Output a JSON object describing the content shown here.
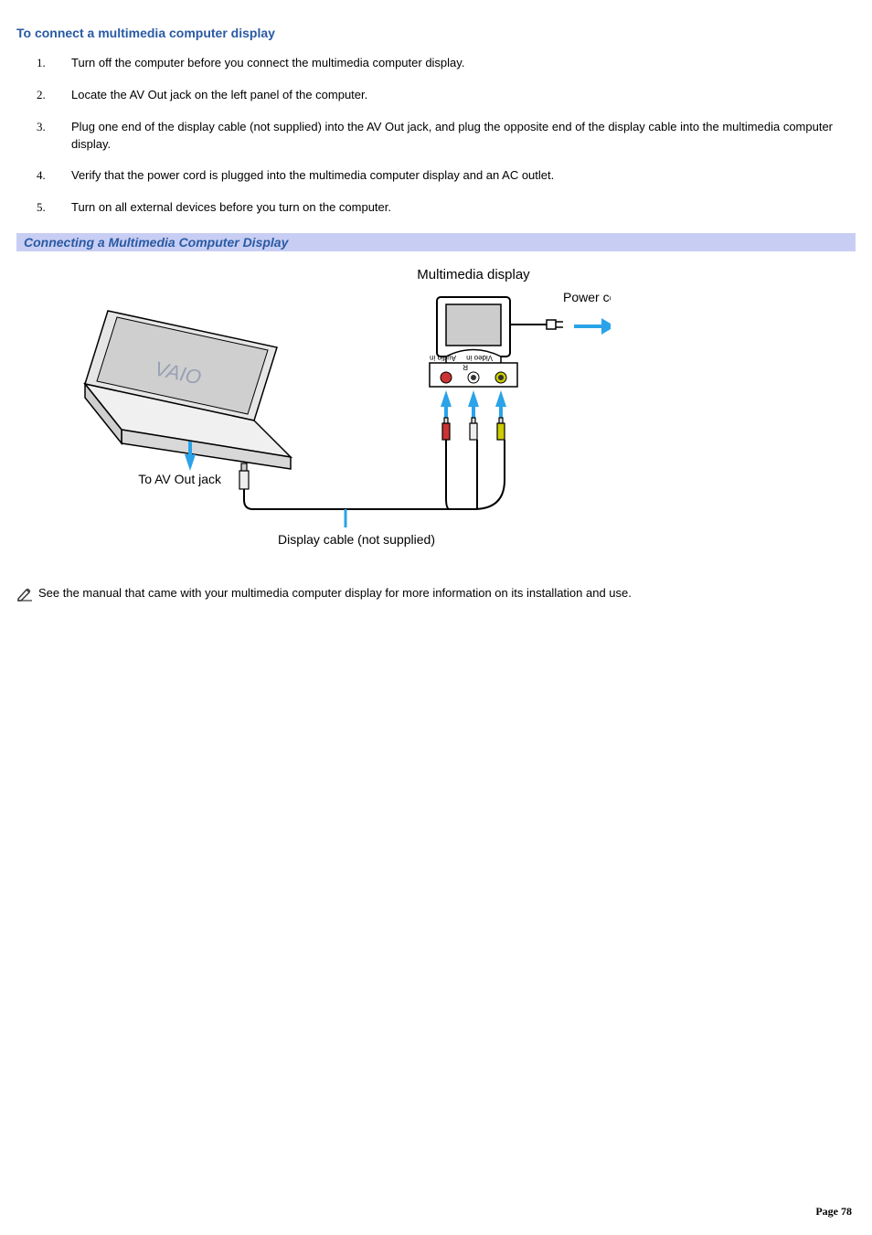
{
  "heading": "To connect a multimedia computer display",
  "steps": [
    "Turn off the computer before you connect the multimedia computer display.",
    "Locate the AV Out jack on the left panel of the computer.",
    "Plug one end of the display cable (not supplied) into the AV Out jack, and plug the opposite end of the display cable into the multimedia computer display.",
    "Verify that the power cord is plugged into the multimedia computer display and an AC outlet.",
    "Turn on all external devices before you turn on the computer."
  ],
  "section_bar": "Connecting a Multimedia Computer Display",
  "figure": {
    "label_multimedia_display": "Multimedia display",
    "label_power_cord": "Power cord",
    "label_av_out": "To AV Out jack",
    "label_display_cable": "Display cable (not supplied)",
    "label_audio_in": "Audio in",
    "label_r": "R",
    "label_video_in": "Video in"
  },
  "note_text": "See the manual that came with your multimedia computer display for more information on its installation and use.",
  "page_label": "Page 78"
}
